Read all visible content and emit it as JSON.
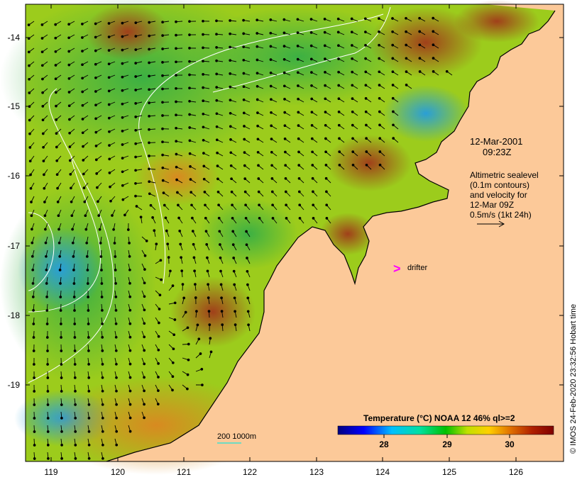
{
  "map": {
    "lat_ticks": [
      "-14",
      "-15",
      "-16",
      "-17",
      "-18",
      "-19"
    ],
    "lon_ticks": [
      "119",
      "120",
      "121",
      "122",
      "123",
      "124",
      "125",
      "126"
    ],
    "date": "12-Mar-2001",
    "time": "09:23Z",
    "altimetry_lines": [
      "Altimetric sealevel",
      "(0.1m contours)",
      "and velocity for",
      "12-Mar 09Z",
      "0.5m/s (1kt 24h)"
    ],
    "drifter_symbol": ">",
    "drifter_label": "drifter",
    "depth_label": "200  1000m",
    "colorbar": {
      "title": "Temperature (°C) NOAA 12 46% ql>=2",
      "ticks": [
        "28",
        "29",
        "30"
      ]
    },
    "credit": "© IMOS 24-Feb-2020 23:32:56 Hobart time",
    "colors": {
      "land": "#fcc999",
      "drifter": "#ff00ff",
      "depth_contour": "#40e0d0"
    }
  }
}
